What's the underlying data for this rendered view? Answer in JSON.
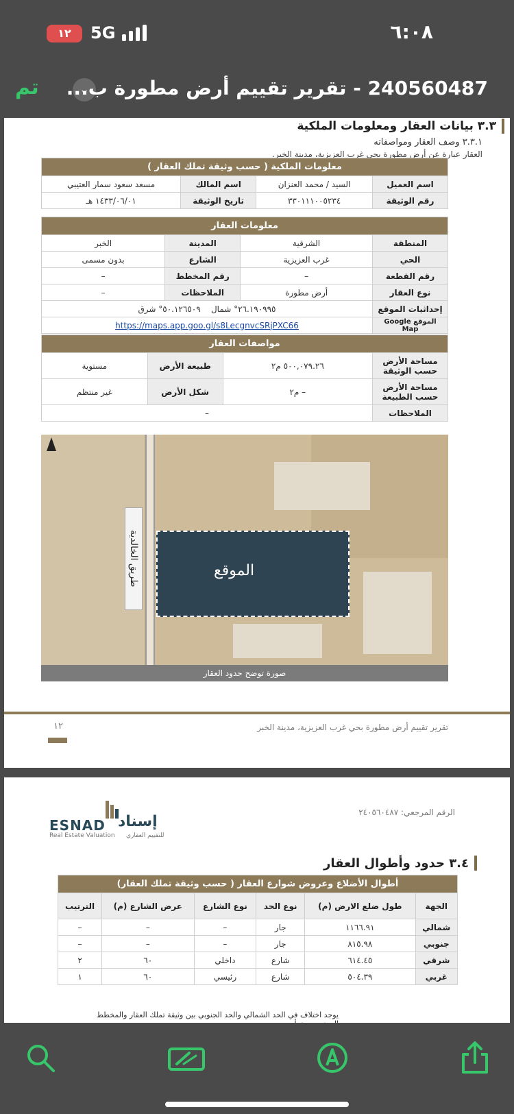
{
  "status_bar": {
    "time": "٦:٠٨",
    "battery": "١٢",
    "network": "5G"
  },
  "nav": {
    "done_label": "تم",
    "title": "240560487 - تقرير تقييم أرض مطورة ب..."
  },
  "page1": {
    "section_title": "٣.٣ بيانات العقار ومعلومات الملكية",
    "subsection_title": "٣.٣.١ وصف العقار ومواصفاته",
    "description": "العقار عبارة عن أرض مطورة بحي غرب العزيزية، مدينة الخبر.",
    "ownership": {
      "header": "معلومات الملكية ( حسب وثيقة تملك العقار )",
      "client_label": "اسم العميل",
      "client_value": "السيد / محمد العنزان",
      "owner_label": "اسم المالك",
      "owner_value": "مسعد سعود سمار العتيبي",
      "deed_no_label": "رقم الوثيقة",
      "deed_no_value": "٣٣٠١١١٠٠٥٢٣٤",
      "deed_date_label": "تاريخ الوثيقة",
      "deed_date_value": "١٤٣٣/٠٦/٠١ هـ"
    },
    "property": {
      "header": "معلومات العقار",
      "region_label": "المنطقة",
      "region_value": "الشرقية",
      "city_label": "المدينة",
      "city_value": "الخبر",
      "district_label": "الحي",
      "district_value": "غرب العزيزية",
      "street_label": "الشارع",
      "street_value": "بدون مسمى",
      "plot_label": "رقم القطعة",
      "plot_value": "–",
      "plan_label": "رقم المخطط",
      "plan_value": "–",
      "type_label": "نوع العقار",
      "type_value": "أرض مطورة",
      "notes_label": "الملاحظات",
      "notes_value": "–",
      "coords_label": "إحداثيات الموقع",
      "coords_north": "٢٦.١٩٠٩٩٥° شمال",
      "coords_east": "٥٠.١٢٦٥٠٩° شرق",
      "googlemap_label": "الموقع Google Map",
      "googlemap_link": "https://maps.app.goo.gl/s8LecgnvcSRjPXC66"
    },
    "specs": {
      "header": "مواصفات العقار",
      "area_deed_label": "مساحة الأرض حسب الوثيقة",
      "area_deed_value": "٥٠٠,٠٧٩.٢٦ م٢",
      "nature_label": "طبيعة الأرض",
      "nature_value": "مستوية",
      "area_nature_label": "مساحة الأرض حسب الطبيعة",
      "area_nature_value": "– م٢",
      "shape_label": "شكل الأرض",
      "shape_value": "غير منتظم",
      "notes_label": "الملاحظات",
      "notes_value": "–"
    },
    "map": {
      "road_label": "طريق الخالدية",
      "site_label": "الموقع",
      "caption": "صورة توضح حدود العقار"
    },
    "footer_text": "تقرير تقييم أرض مطورة بحي غرب العزيزية، مدينة الخبر",
    "page_number": "١٢"
  },
  "page2": {
    "reference": "الرقم المرجعي: ٢٤٠٥٦٠٤٨٧",
    "logo_en": "ESNAD",
    "logo_en_sub": "Real Estate Valuation",
    "logo_ar": "إسناد",
    "logo_ar_sub": "للتقييم العقاري",
    "section_title": "٣.٤ حدود وأطوال العقار",
    "table_header": "أطوال الأضلاع وعروض شوارع العقار ( حسب وثيقة تملك العقار)",
    "columns": [
      "الجهة",
      "طول ضلع الارض (م)",
      "نوع الحد",
      "نوع الشارع",
      "عرض الشارع (م)",
      "الترتيب"
    ],
    "rows": [
      [
        "شمالي",
        "١١٦٦.٩١",
        "جار",
        "–",
        "–",
        "–"
      ],
      [
        "جنوبي",
        "٨١٥.٩٨",
        "جار",
        "–",
        "–",
        "–"
      ],
      [
        "شرقي",
        "٦١٤.٤٥",
        "شارع",
        "داخلي",
        "٦٠",
        "٢"
      ],
      [
        "غربي",
        "٥٠٤.٣٩",
        "شارع",
        "رئيسي",
        "٦٠",
        "١"
      ]
    ],
    "note": "يوجد اختلاف في الحد الشمالي والحد الجنوبي بين وثيقة تملك العقار والمخطط المعتمد حيث أن"
  },
  "toolbar": {
    "icons": [
      "search-icon",
      "markup-icon",
      "pen-icon",
      "share-icon"
    ],
    "accent": "#38c66b"
  }
}
